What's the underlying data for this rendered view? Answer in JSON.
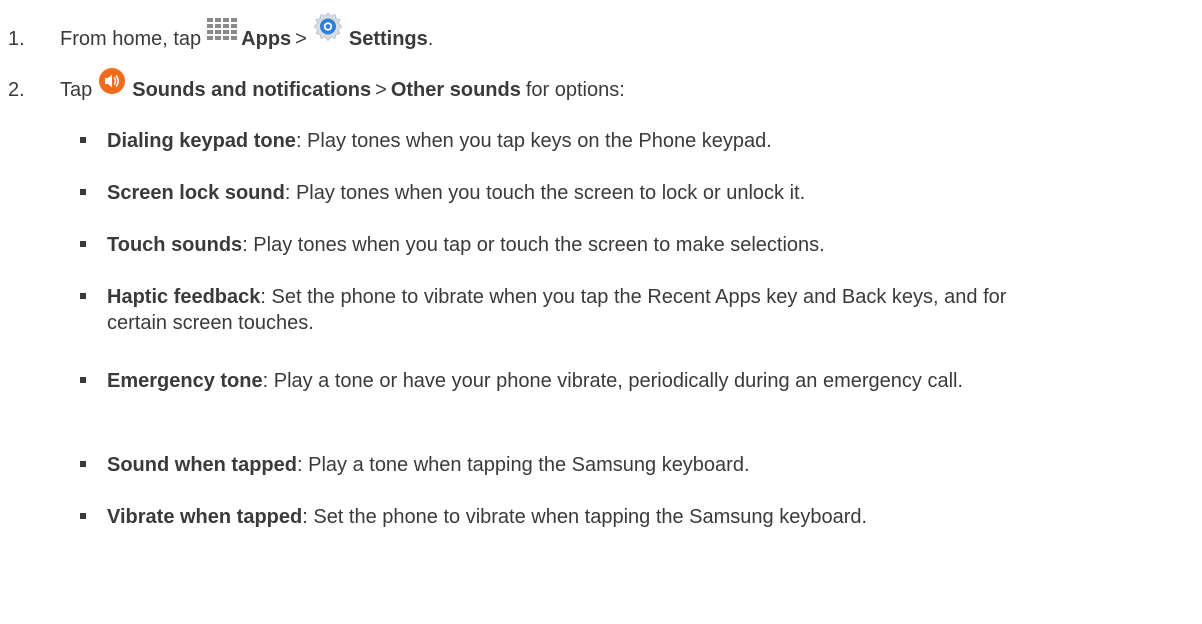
{
  "steps": [
    {
      "number": "1.",
      "pre": "From home, tap",
      "apps_label": "Apps",
      "sep": ">",
      "settings_label": "Settings",
      "post": "."
    },
    {
      "number": "2.",
      "pre": "Tap",
      "sounds_label": "Sounds and notifications",
      "sep": ">",
      "other_label": "Other sounds",
      "post": "for options:"
    }
  ],
  "options": [
    {
      "term": "Dialing keypad tone",
      "desc": ": Play tones when you tap keys on the Phone keypad."
    },
    {
      "term": "Screen lock sound",
      "desc": ": Play tones when you touch the screen to lock or unlock it."
    },
    {
      "term": "Touch sounds",
      "desc": ": Play tones when you tap or touch the screen to make selections."
    },
    {
      "term": "Haptic feedback",
      "desc": ": Set the phone to vibrate when you tap the Recent Apps key and Back keys, and for certain screen touches."
    },
    {
      "term": "Emergency tone",
      "desc": ": Play a tone or have your phone vibrate, periodically during an emergency call."
    },
    {
      "term": "Sound when tapped",
      "desc": ": Play a tone when tapping the Samsung keyboard."
    },
    {
      "term": "Vibrate when tapped",
      "desc": ": Set the phone to vibrate when tapping the Samsung keyboard."
    }
  ],
  "icons": {
    "apps": "apps-grid-icon",
    "settings": "settings-gear-icon",
    "sounds": "sound-speaker-icon"
  },
  "colors": {
    "text": "#3a3a3a",
    "apps_icon": "#8a8a8a",
    "settings_icon": "#2f7fd6",
    "sounds_icon": "#f26a1b"
  }
}
